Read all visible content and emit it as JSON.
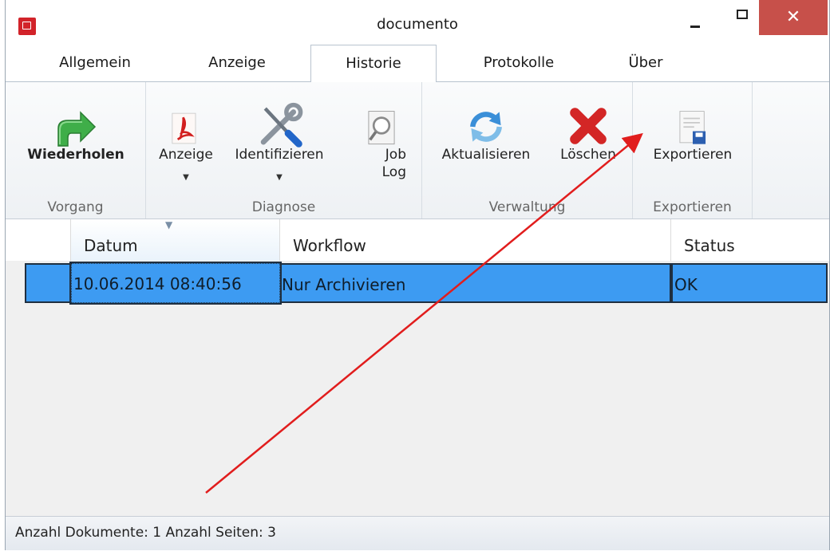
{
  "window": {
    "title": "documento"
  },
  "tabs": [
    {
      "label": "Allgemein"
    },
    {
      "label": "Anzeige"
    },
    {
      "label": "Historie",
      "active": true
    },
    {
      "label": "Protokolle"
    },
    {
      "label": "Über"
    }
  ],
  "ribbon": {
    "groups": {
      "vorgang": {
        "label": "Vorgang",
        "buttons": {
          "wiederholen": "Wiederholen"
        }
      },
      "diagnose": {
        "label": "Diagnose",
        "buttons": {
          "anzeige": "Anzeige",
          "identifizieren": "Identifizieren",
          "joblog": "Job\nLog"
        }
      },
      "verwaltung": {
        "label": "Verwaltung",
        "buttons": {
          "aktualisieren": "Aktualisieren",
          "loeschen": "Löschen"
        }
      },
      "exportieren": {
        "label": "Exportieren",
        "buttons": {
          "exportieren": "Exportieren"
        }
      }
    }
  },
  "grid": {
    "columns": {
      "datum": "Datum",
      "workflow": "Workflow",
      "status": "Status"
    },
    "rows": [
      {
        "datum": "10.06.2014 08:40:56",
        "workflow": "Nur Archivieren",
        "status": "OK"
      }
    ]
  },
  "statusbar": {
    "text": "Anzahl Dokumente: 1  Anzahl Seiten: 3"
  },
  "colors": {
    "selection": "#3d9bf2",
    "close_button": "#c7504a",
    "annotation_arrow": "#e11d1d"
  },
  "icons": {
    "app": "app-icon",
    "redo": "green-arrow-icon",
    "pdf": "pdf-icon",
    "tools": "wrench-screwdriver-icon",
    "joblog": "magnifier-document-icon",
    "refresh": "refresh-icon",
    "delete": "red-x-icon",
    "export": "save-document-icon"
  }
}
